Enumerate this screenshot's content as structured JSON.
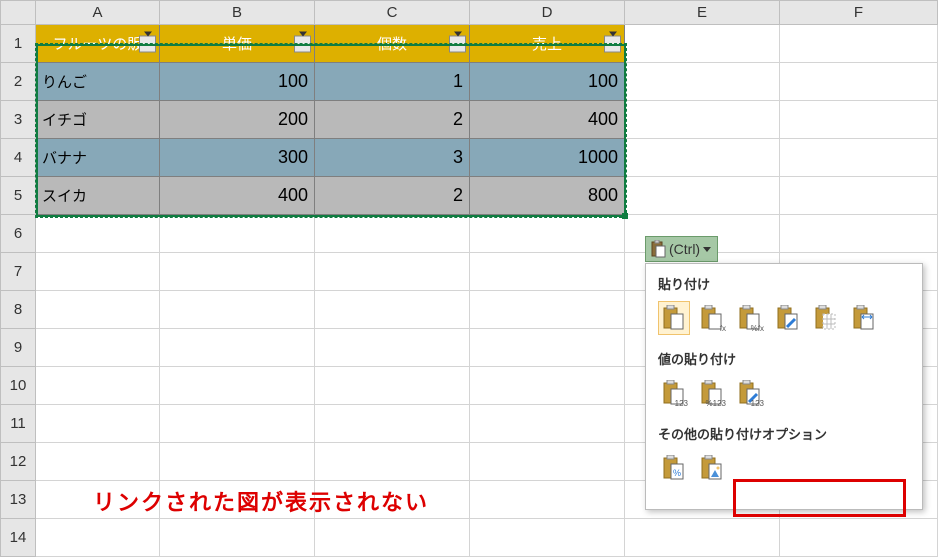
{
  "columns": [
    "A",
    "B",
    "C",
    "D",
    "E",
    "F"
  ],
  "rows": [
    "1",
    "2",
    "3",
    "4",
    "5",
    "6",
    "7",
    "8",
    "9",
    "10",
    "11",
    "12",
    "13",
    "14"
  ],
  "table": {
    "headers": [
      "フルーツの販",
      "単価",
      "個数",
      "売上"
    ],
    "rows": [
      {
        "name": "りんご",
        "price": 100,
        "qty": 1,
        "sales": 100
      },
      {
        "name": "イチゴ",
        "price": 200,
        "qty": 2,
        "sales": 400
      },
      {
        "name": "バナナ",
        "price": 300,
        "qty": 3,
        "sales": 1000
      },
      {
        "name": "スイカ",
        "price": 400,
        "qty": 2,
        "sales": 800
      }
    ]
  },
  "paste_btn_label": "(Ctrl)",
  "paste_panel": {
    "section1": "貼り付け",
    "section2": "値の貼り付け",
    "section3": "その他の貼り付けオプション"
  },
  "annotation_text": "リンクされた図が表示されない"
}
